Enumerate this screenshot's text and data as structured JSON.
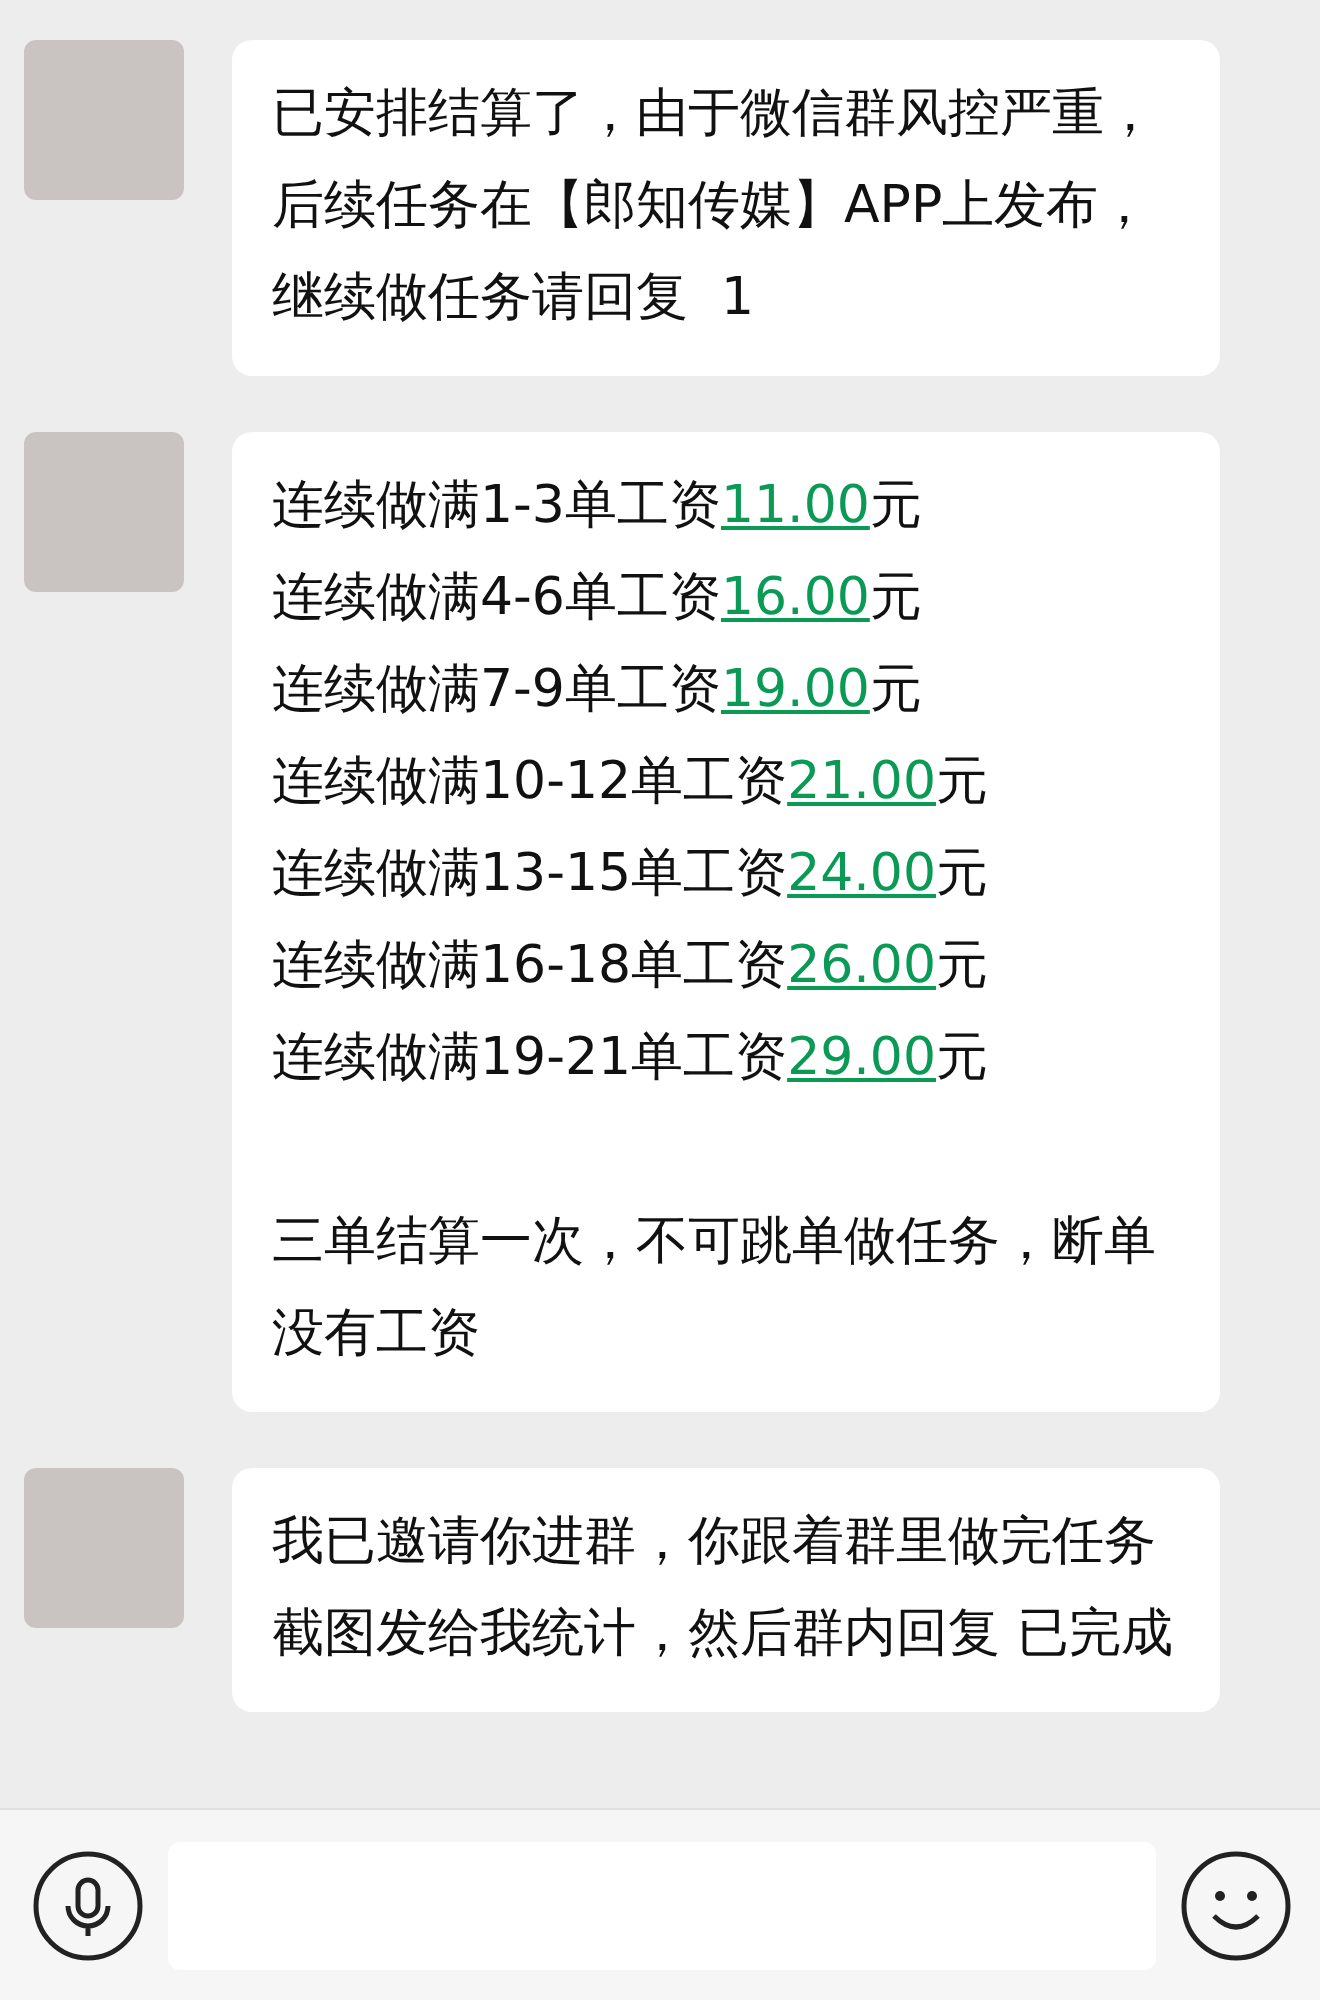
{
  "messages": [
    {
      "kind": "text",
      "text": "已安排结算了，由于微信群风控严重，后续任务在【郎知传媒】APP上发布，继续做任务请回复  1"
    },
    {
      "kind": "tiers",
      "tiers": [
        {
          "label": "连续做满1-3单工资",
          "amount": "11.00",
          "unit": "元"
        },
        {
          "label": "连续做满4-6单工资",
          "amount": "16.00",
          "unit": "元"
        },
        {
          "label": "连续做满7-9单工资",
          "amount": "19.00",
          "unit": "元"
        },
        {
          "label": "连续做满10-12单工资",
          "amount": "21.00",
          "unit": "元"
        },
        {
          "label": "连续做满13-15单工资",
          "amount": "24.00",
          "unit": "元"
        },
        {
          "label": "连续做满16-18单工资",
          "amount": "26.00",
          "unit": "元"
        },
        {
          "label": "连续做满19-21单工资",
          "amount": "29.00",
          "unit": "元"
        }
      ],
      "note": "三单结算一次，不可跳单做任务，断单没有工资"
    },
    {
      "kind": "text",
      "text": "我已邀请你进群，你跟着群里做完任务截图发给我统计，然后群内回复 已完成"
    }
  ]
}
